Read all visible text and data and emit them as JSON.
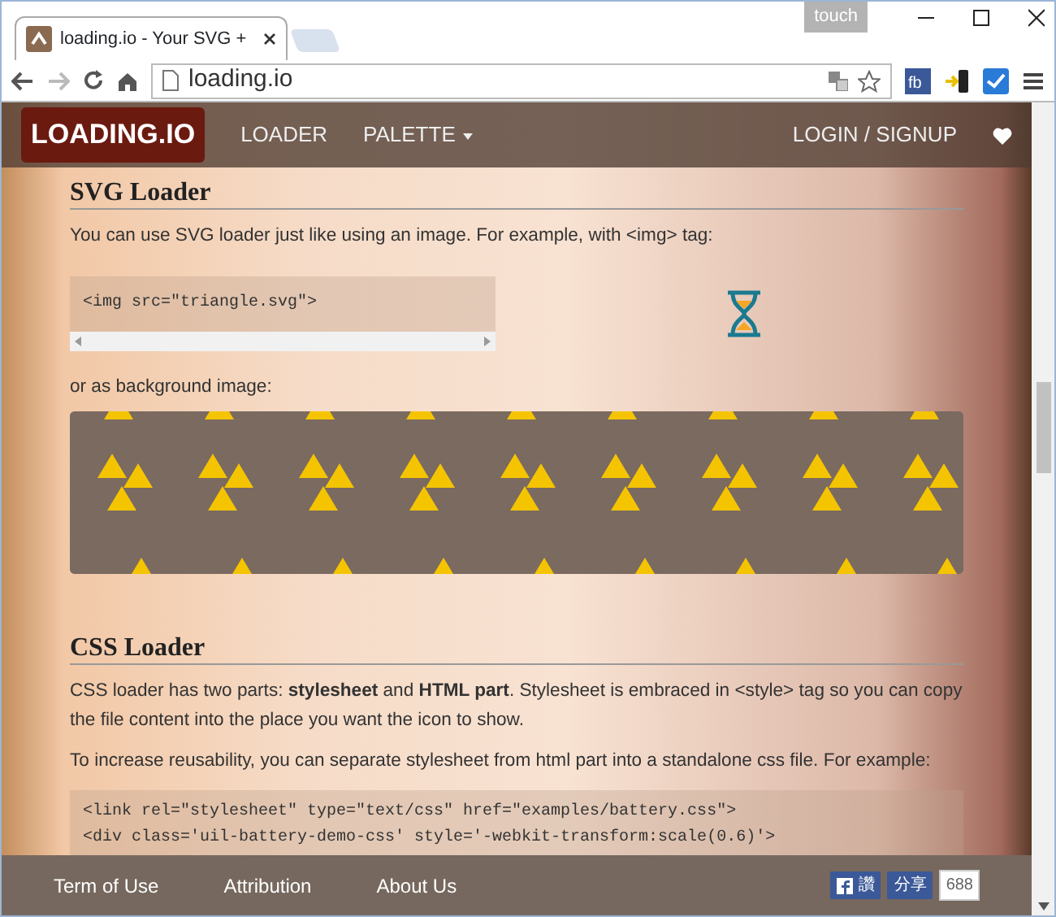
{
  "browser": {
    "tab_title": "loading.io - Your SVG + ",
    "badge": "touch",
    "address": "loading.io",
    "back_disabled": false,
    "forward_disabled": true,
    "extension_label": "fb"
  },
  "navbar": {
    "brand": "LOADING.IO",
    "items": [
      {
        "label": "LOADER",
        "dropdown": false
      },
      {
        "label": "PALETTE",
        "dropdown": true
      }
    ],
    "login": "LOGIN / SIGNUP"
  },
  "svg_section": {
    "title": "SVG Loader",
    "intro": "You can use SVG loader just like using an image. For example, with <img> tag:",
    "code": "<img src=\"triangle.svg\">",
    "after": "or as background image:"
  },
  "css_section": {
    "title": "CSS Loader",
    "paragraphs": [
      "CSS loader has two parts: **stylesheet** and **HTML part**. Stylesheet is embraced in <style> tag so you can copy the file content into the place you want the icon to show.",
      "To increase reusability, you can separate stylesheet from html part into a standalone css file. For example:"
    ],
    "code": [
      "<link rel=\"stylesheet\" type=\"text/css\" href=\"examples/battery.css\">",
      "<div class='uil-battery-demo-css' style='-webkit-transform:scale(0.6)'>"
    ]
  },
  "footer": {
    "links": [
      "Term of Use",
      "Attribution",
      "About Us"
    ],
    "fb_label": "讚",
    "share": "分享",
    "count": "688"
  }
}
